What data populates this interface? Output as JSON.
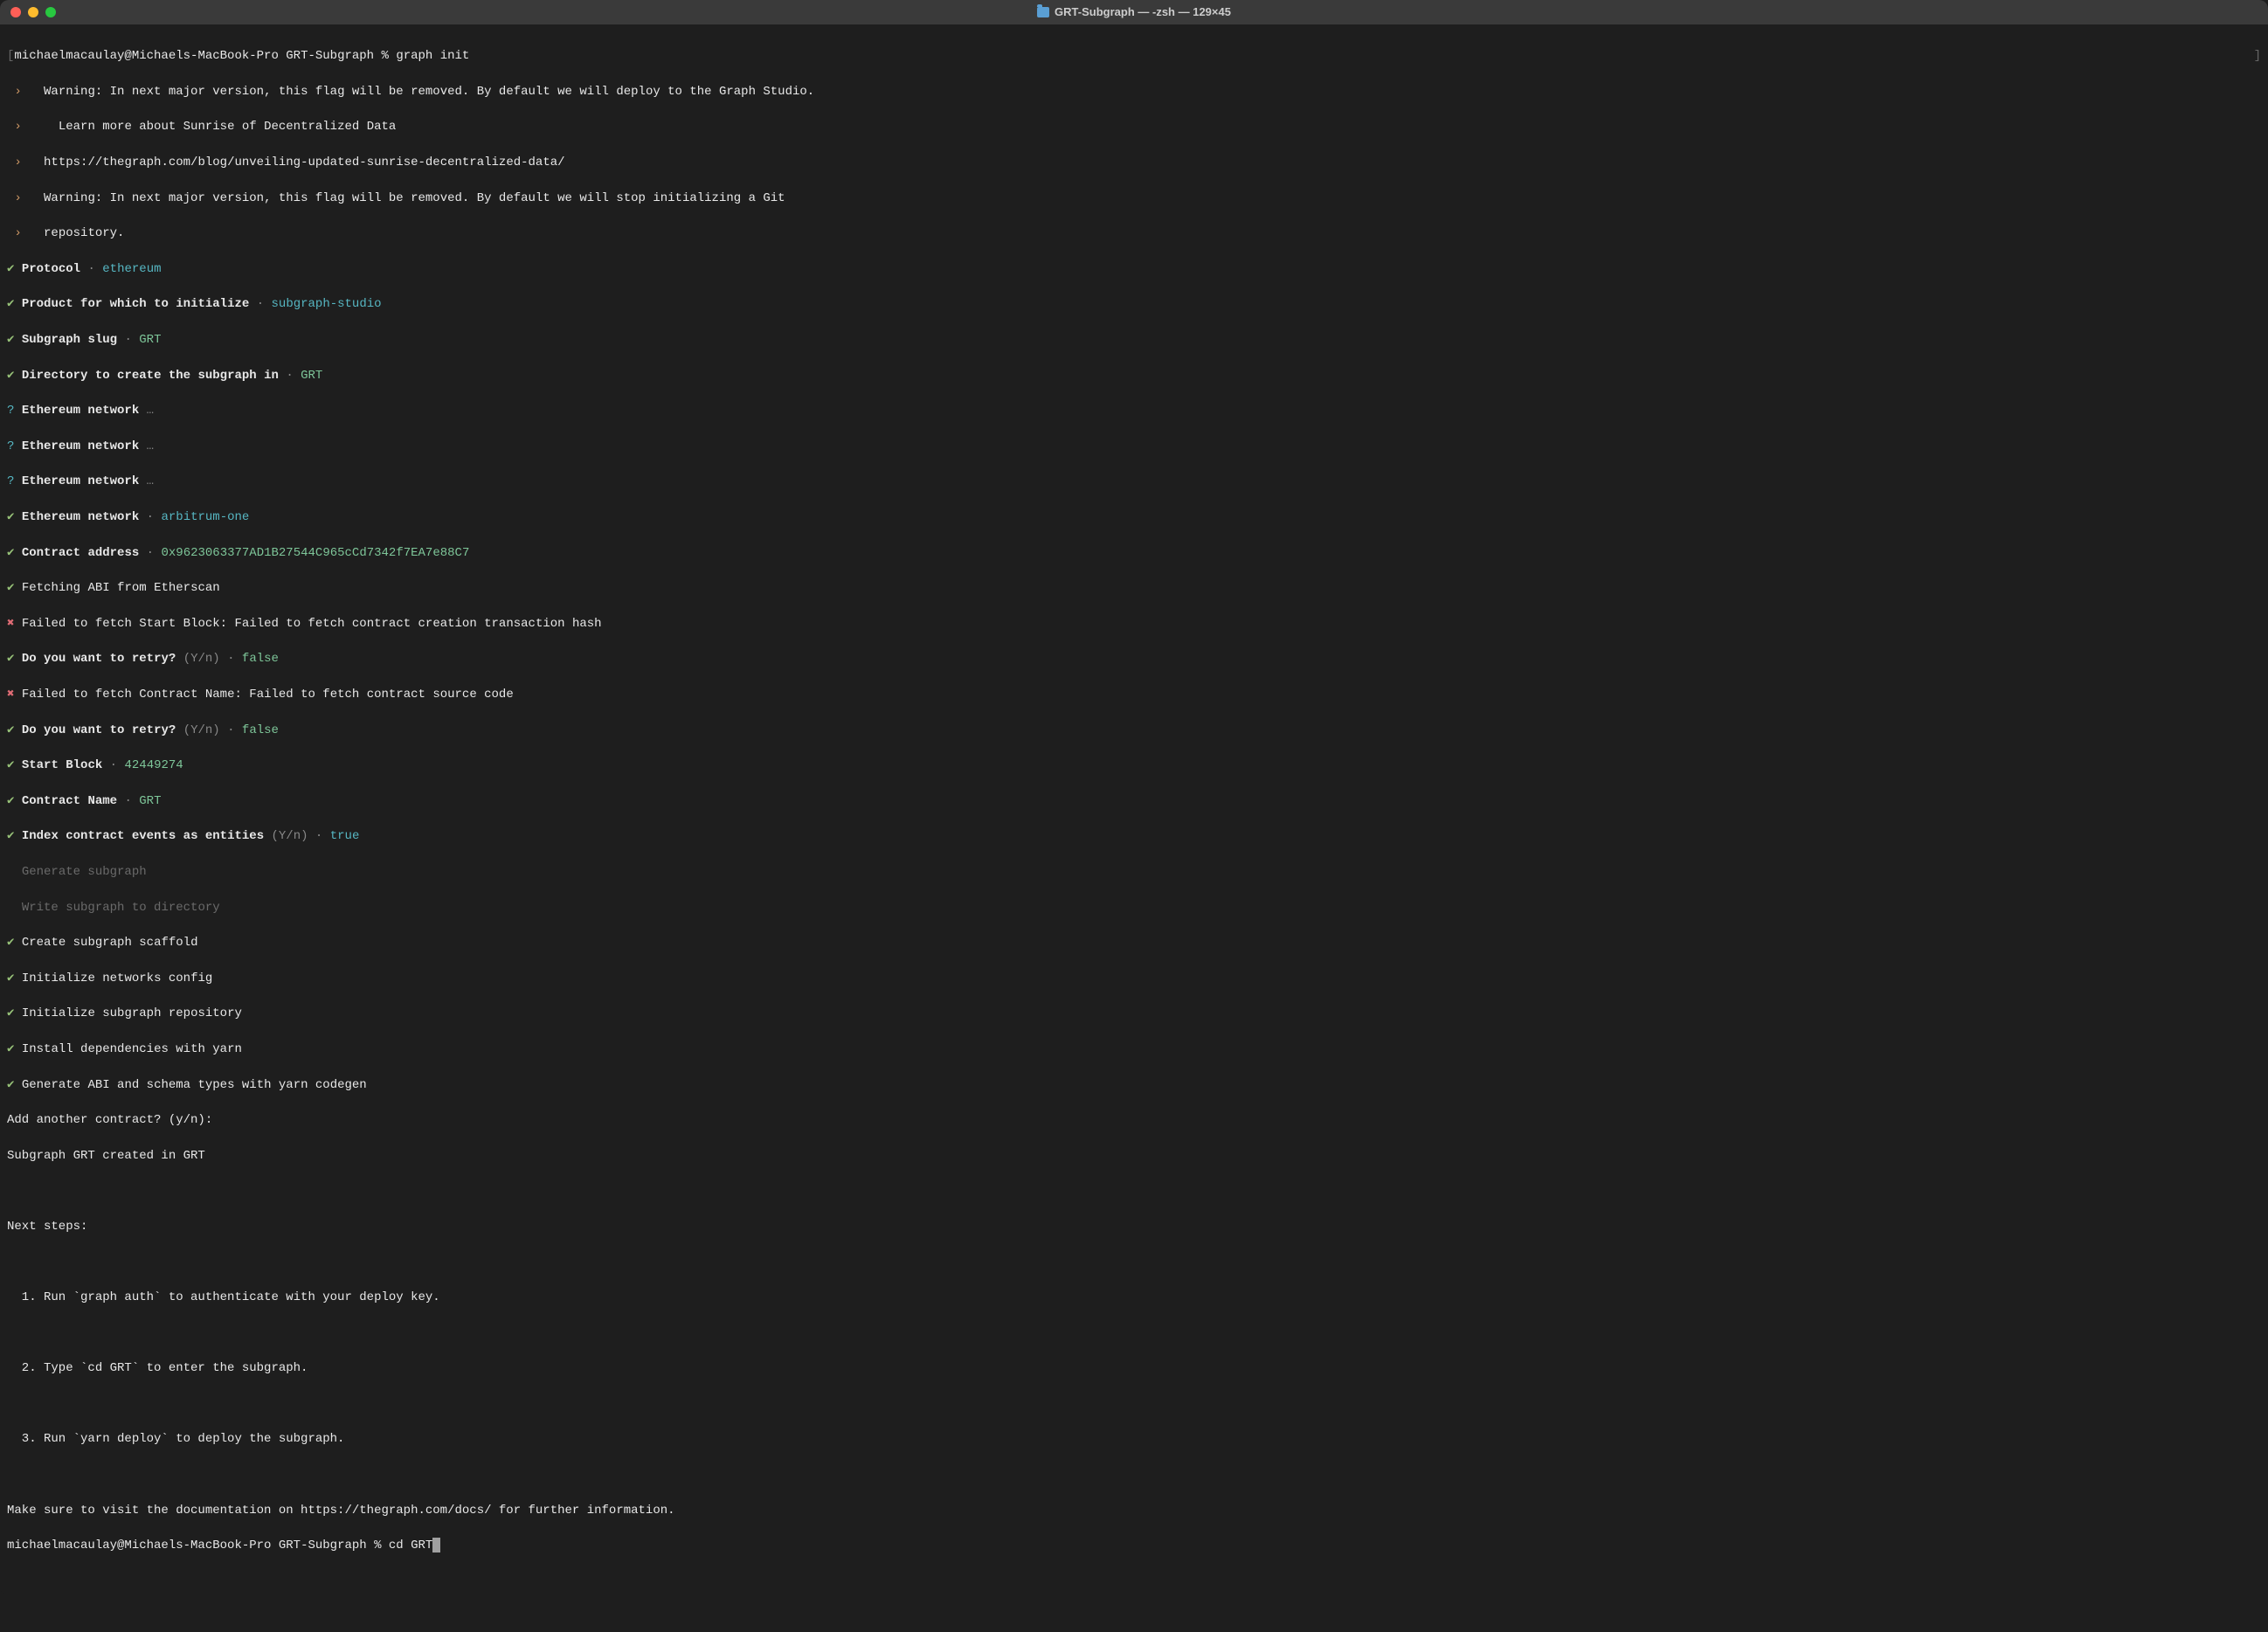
{
  "window": {
    "title": "GRT-Subgraph — -zsh — 129×45"
  },
  "prompt1": {
    "user_host": "michaelmacaulay@Michaels-MacBook-Pro",
    "dir": "GRT-Subgraph",
    "symbol": "%",
    "command": "graph init",
    "left_bracket": "[",
    "right_bracket": "]"
  },
  "warnings": {
    "w1": "Warning: In next major version, this flag will be removed. By default we will deploy to the Graph Studio.",
    "w2": "  Learn more about Sunrise of Decentralized Data",
    "w3": "https://thegraph.com/blog/unveiling-updated-sunrise-decentralized-data/",
    "w4": "Warning: In next major version, this flag will be removed. By default we will stop initializing a Git",
    "w5": "repository.",
    "arrow": "›"
  },
  "prompts": {
    "protocol_label": "Protocol",
    "protocol_value": "ethereum",
    "product_label": "Product for which to initialize",
    "product_value": "subgraph-studio",
    "slug_label": "Subgraph slug",
    "slug_value": "GRT",
    "dir_label": "Directory to create the subgraph in",
    "dir_value": "GRT",
    "eth_net_label": "Ethereum network",
    "ellipsis": "…",
    "eth_net_value": "arbitrum-one",
    "contract_addr_label": "Contract address",
    "contract_addr_value": "0x9623063377AD1B27544C965cCd7342f7EA7e88C7",
    "fetching_abi": "Fetching ABI from Etherscan",
    "fail_start_block": "Failed to fetch Start Block: Failed to fetch contract creation transaction hash",
    "retry_label": "Do you want to retry?",
    "retry_hint": "(Y/n)",
    "retry_value": "false",
    "fail_contract_name": "Failed to fetch Contract Name: Failed to fetch contract source code",
    "start_block_label": "Start Block",
    "start_block_value": "42449274",
    "contract_name_label": "Contract Name",
    "contract_name_value": "GRT",
    "index_events_label": "Index contract events as entities",
    "index_events_hint": "(Y/n)",
    "index_events_value": "true",
    "gen_subgraph": "Generate subgraph",
    "write_subgraph": "Write subgraph to directory",
    "create_scaffold": "Create subgraph scaffold",
    "init_networks": "Initialize networks config",
    "init_repo": "Initialize subgraph repository",
    "install_deps": "Install dependencies with yarn",
    "gen_abi": "Generate ABI and schema types with yarn codegen",
    "check": "✔",
    "cross": "✖",
    "question": "?",
    "dot": "·"
  },
  "footer": {
    "add_another": "Add another contract? (y/n):",
    "created": "Subgraph GRT created in GRT",
    "next_steps": "Next steps:",
    "step1": "  1. Run `graph auth` to authenticate with your deploy key.",
    "step2": "  2. Type `cd GRT` to enter the subgraph.",
    "step3": "  3. Run `yarn deploy` to deploy the subgraph.",
    "docs": "Make sure to visit the documentation on https://thegraph.com/docs/ for further information."
  },
  "prompt2": {
    "user_host": "michaelmacaulay@Michaels-MacBook-Pro",
    "dir": "GRT-Subgraph",
    "symbol": "%",
    "command": "cd GRT"
  }
}
